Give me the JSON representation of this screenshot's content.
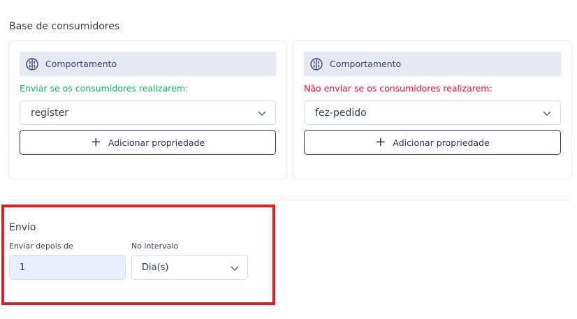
{
  "section": {
    "title": "Base de consumidores"
  },
  "include_card": {
    "header_label": "Comportamento",
    "header_icon": "brain-icon",
    "rule_label": "Enviar se os consumidores realizarem:",
    "rule_color": "#1fb15a",
    "select_value": "register",
    "add_button_label": "Adicionar propriedade"
  },
  "exclude_card": {
    "header_label": "Comportamento",
    "header_icon": "brain-icon",
    "rule_label": "Não enviar se os consumidores realizarem:",
    "rule_color": "#e0153a",
    "select_value": "fez-pedido",
    "add_button_label": "Adicionar propriedade"
  },
  "envio": {
    "title": "Envio",
    "delay_label": "Enviar depois de",
    "delay_value": "1",
    "interval_label": "No intervalo",
    "interval_value": "Dia(s)"
  },
  "colors": {
    "accent": "#2a3264",
    "highlight": "#e01e24"
  }
}
